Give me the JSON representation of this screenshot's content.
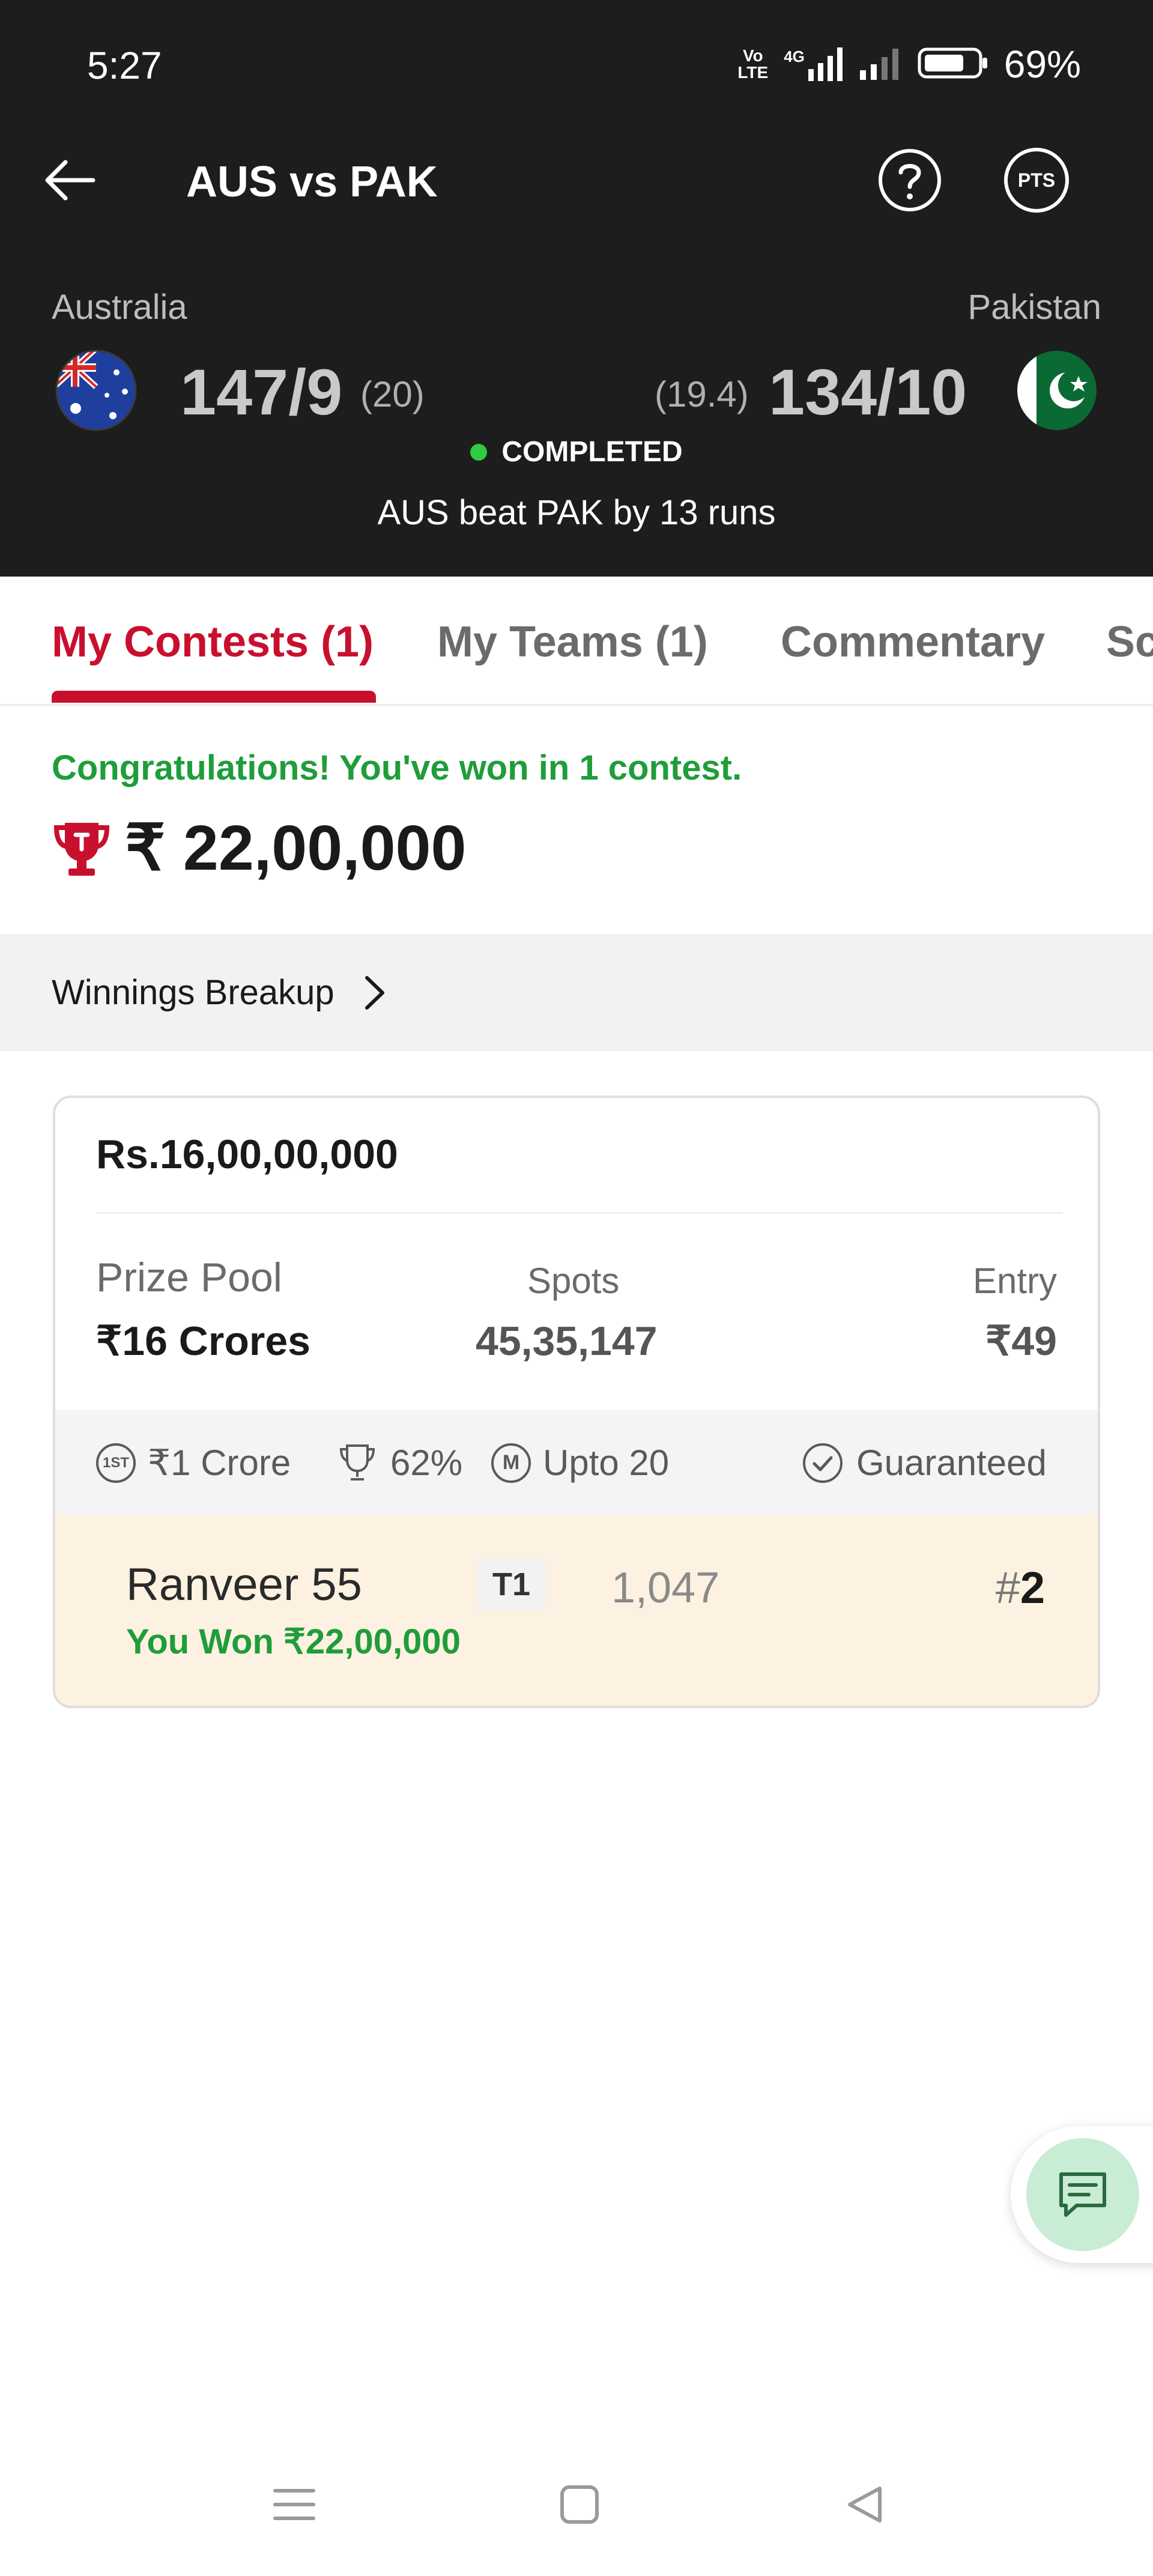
{
  "status_bar": {
    "time": "5:27",
    "network_labels": [
      "Vo",
      "LTE"
    ],
    "network_type": "4G",
    "battery": "69%"
  },
  "app_bar": {
    "title": "AUS vs PAK",
    "pts_label": "PTS"
  },
  "match": {
    "team1": {
      "name": "Australia",
      "score": "147/9",
      "overs": "(20)"
    },
    "team2": {
      "name": "Pakistan",
      "score": "134/10",
      "overs": "(19.4)"
    },
    "status": "COMPLETED",
    "result": "AUS beat PAK by 13 runs"
  },
  "tabs": [
    {
      "label": "My Contests (1)",
      "active": true
    },
    {
      "label": "My Teams (1)",
      "active": false
    },
    {
      "label": "Commentary",
      "active": false
    },
    {
      "label": "Scorecard",
      "active": false
    }
  ],
  "winnings": {
    "message": "Congratulations! You've won in 1 contest.",
    "amount": "₹ 22,00,000",
    "breakup_label": "Winnings Breakup"
  },
  "contest": {
    "title": "Rs.16,00,00,000",
    "prize_pool_label": "Prize Pool",
    "prize_pool_value": "₹16 Crores",
    "spots_label": "Spots",
    "spots_value": "45,35,147",
    "entry_label": "Entry",
    "entry_value": "₹49",
    "features": {
      "first_prize_badge": "1ST",
      "first_prize": "₹1 Crore",
      "winners_percent": "62%",
      "multi_entry_badge": "M",
      "multi_entry": "Upto 20",
      "guaranteed": "Guaranteed"
    },
    "team_entry": {
      "name": "Ranveer 55",
      "team_tag": "T1",
      "points": "1,047",
      "rank_prefix": "#",
      "rank": "2",
      "won_text": "You Won ₹22,00,000"
    }
  },
  "colors": {
    "header_bg": "#1d1d1d",
    "accent_red": "#c8102e",
    "success_green": "#1f9d3a",
    "winning_row_bg": "#fdf2e1"
  },
  "icons": {
    "back": "arrow-left-icon",
    "help": "question-circle-icon",
    "pts": "points-icon",
    "trophy": "trophy-icon",
    "chevron": "chevron-right-icon",
    "chat": "chat-icon"
  }
}
